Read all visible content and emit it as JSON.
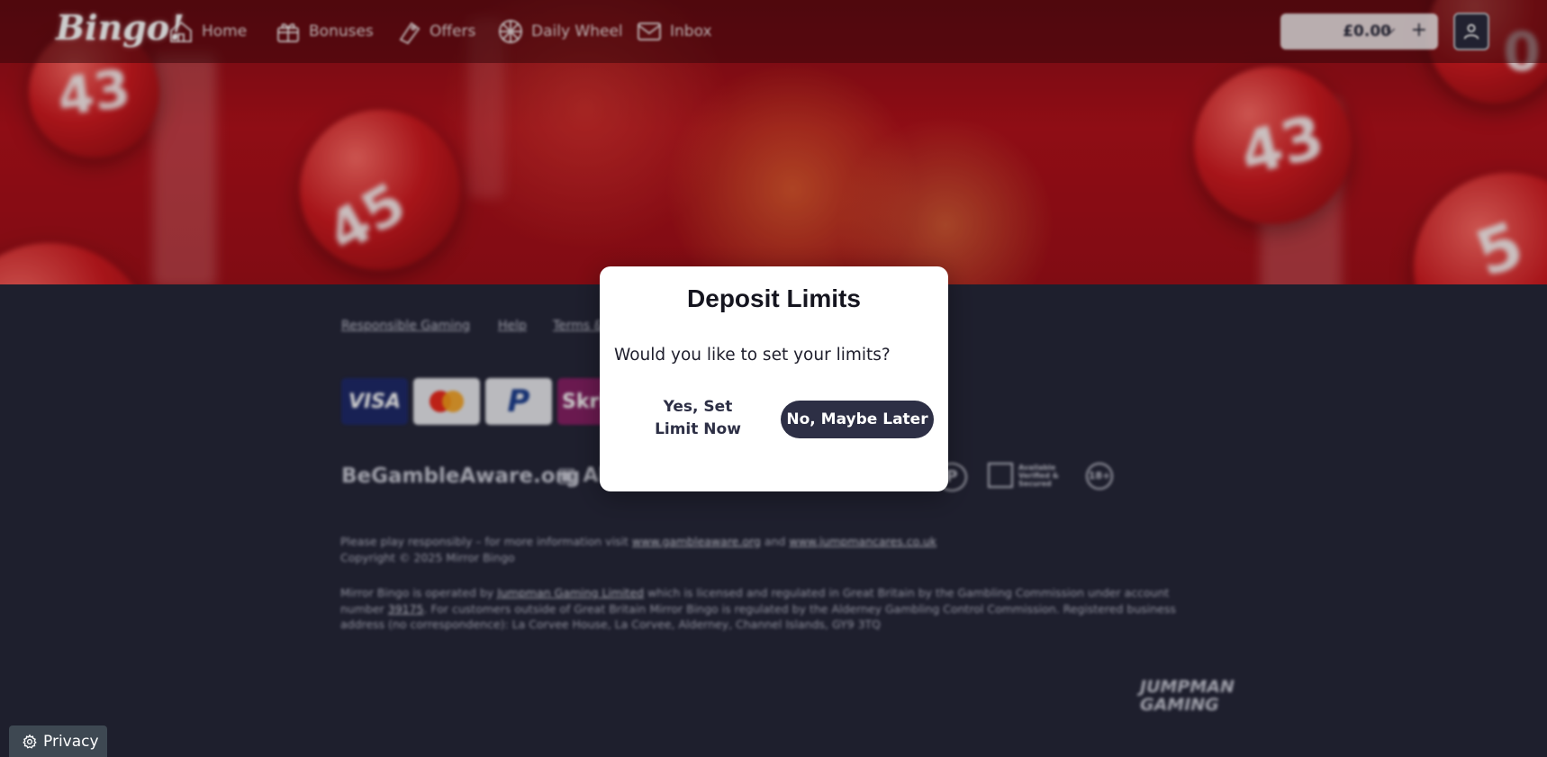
{
  "brand": {
    "logo_text": "Bingo!"
  },
  "nav": {
    "items": [
      {
        "label": "Home",
        "icon": "home-icon"
      },
      {
        "label": "Bonuses",
        "icon": "gift-icon"
      },
      {
        "label": "Offers",
        "icon": "offers-icon"
      },
      {
        "label": "Daily Wheel",
        "icon": "wheel-icon"
      },
      {
        "label": "Inbox",
        "icon": "envelope-icon"
      }
    ],
    "balance": "£0.00"
  },
  "hero": {
    "balls": [
      "43",
      "45",
      "43",
      "5",
      "0"
    ]
  },
  "footer": {
    "links": [
      "Responsible Gaming",
      "Help",
      "Terms &"
    ],
    "payments": [
      "VISA",
      "Mastercard",
      "PayPal",
      "Skrill"
    ],
    "regulators": [
      "BeGambleAware.org",
      "Alderney",
      "Available Verified & Secured",
      "18+"
    ],
    "text1": "Please play responsibly – for more information visit",
    "link1": "www.gambleaware.org",
    "and": "and",
    "link2": "www.jumpmancares.co.uk",
    "copyright": "Copyright © 2025 Mirror Bingo",
    "operated_prefix": "Mirror Bingo is operated by",
    "operator": "Jumpman Gaming Limited",
    "operated_suffix": "which is licensed and regulated in Great Britain by the Gambling Commission under account number",
    "account_number": "39175",
    "operated_rest": ". For customers outside of Great Britain Mirror Bingo is regulated by the Alderney Gambling Control Commission. Registered business address (no correspondence): La Corvee House, La Corvee, Alderney, Channel Islands, GY9 3TQ",
    "jumpman_logo": "JUMPMAN GAMING"
  },
  "modal": {
    "title": "Deposit Limits",
    "message": "Would you like to set your limits?",
    "yes_label": "Yes, Set Limit Now",
    "no_label": "No, Maybe Later"
  },
  "privacy": {
    "label": "Privacy",
    "icon": "gear-icon"
  },
  "colors": {
    "footer_bg": "#262739",
    "hero_red": "#b3111b",
    "button_dark": "#2d2f45",
    "modal_bg": "#ffffff"
  }
}
